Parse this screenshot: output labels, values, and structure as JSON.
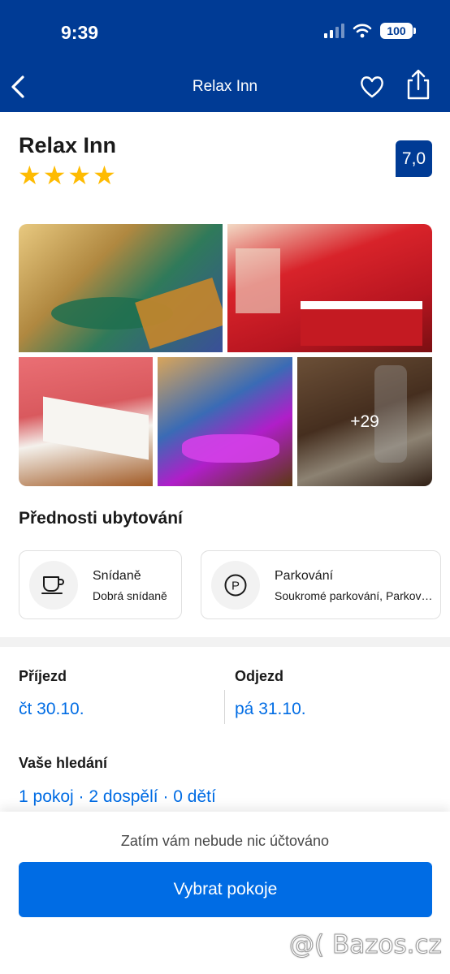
{
  "status_bar": {
    "time": "9:39",
    "battery": "100"
  },
  "nav": {
    "title": "Relax Inn",
    "icons": [
      "chevron-left-icon",
      "heart-icon",
      "share-icon"
    ]
  },
  "hotel": {
    "name": "Relax Inn",
    "stars": 4,
    "score": "7,0"
  },
  "gallery": {
    "more_photos": "+29"
  },
  "highlights": {
    "title": "Přednosti ubytování",
    "items": [
      {
        "icon": "coffee-cup-icon",
        "title": "Snídaně",
        "subtitle": "Dobrá snídaně"
      },
      {
        "icon": "parking-icon",
        "title": "Parkování",
        "subtitle": "Soukromé parkování, Parkování na místě"
      }
    ]
  },
  "dates": {
    "checkin_label": "Příjezd",
    "checkin_value": "čt 30.10.",
    "checkout_label": "Odjezd",
    "checkout_value": "pá 31.10."
  },
  "search": {
    "label": "Vaše hledání",
    "value": "1 pokoj · 2 dospělí · 0 dětí"
  },
  "footer": {
    "note": "Zatím vám nebude nic účtováno",
    "cta_label": "Vybrat pokoje"
  },
  "watermark": "@( Bazos.cz",
  "colors": {
    "brand_blue": "#003b95",
    "action_blue": "#006ce4",
    "star_yellow": "#febb02"
  }
}
